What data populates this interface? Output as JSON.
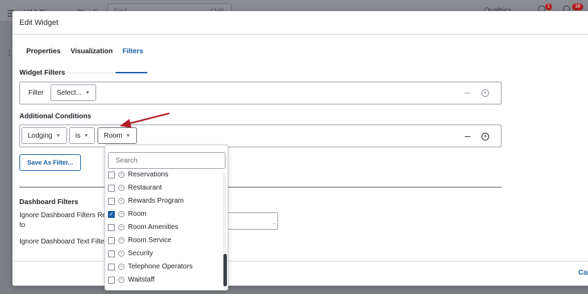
{
  "colors": {
    "accent": "#1b5fa5",
    "annotation_arrow": "#b3202a"
  },
  "background_app": {
    "title": "XM Discover Studio",
    "find_placeholder": "Find",
    "find_suffix": "CMP",
    "account": "Qualtrics",
    "notification_badge": "1",
    "alerts_badge": "18"
  },
  "modal": {
    "title": "Edit Widget",
    "tabs": [
      {
        "label": "Properties",
        "active": false
      },
      {
        "label": "Visualization",
        "active": false
      },
      {
        "label": "Filters",
        "active": true
      }
    ]
  },
  "widget_filters": {
    "heading": "Widget Filters",
    "filter_label": "Filter",
    "select_label": "Select..."
  },
  "additional_conditions": {
    "heading": "Additional Conditions",
    "attribute": "Lodging",
    "operator": "is",
    "value": "Room",
    "save_button": "Save As Filter..."
  },
  "dropdown": {
    "search_placeholder": "Search",
    "items": [
      {
        "label": "Reservations",
        "checked": false
      },
      {
        "label": "Restaurant",
        "checked": false
      },
      {
        "label": "Rewards Program",
        "checked": false
      },
      {
        "label": "Room",
        "checked": true
      },
      {
        "label": "Room Amenities",
        "checked": false
      },
      {
        "label": "Room Service",
        "checked": false
      },
      {
        "label": "Security",
        "checked": false
      },
      {
        "label": "Telephone Operators",
        "checked": false
      },
      {
        "label": "Waitstaff",
        "checked": false
      }
    ]
  },
  "dashboard_filters": {
    "heading": "Dashboard Filters",
    "ignore_filters_line1": "Ignore Dashboard Filters Re",
    "ignore_filters_line2": "to",
    "ignore_text_filter": "Ignore Dashboard Text Filter"
  },
  "footer": {
    "cancel_label": "Can"
  }
}
